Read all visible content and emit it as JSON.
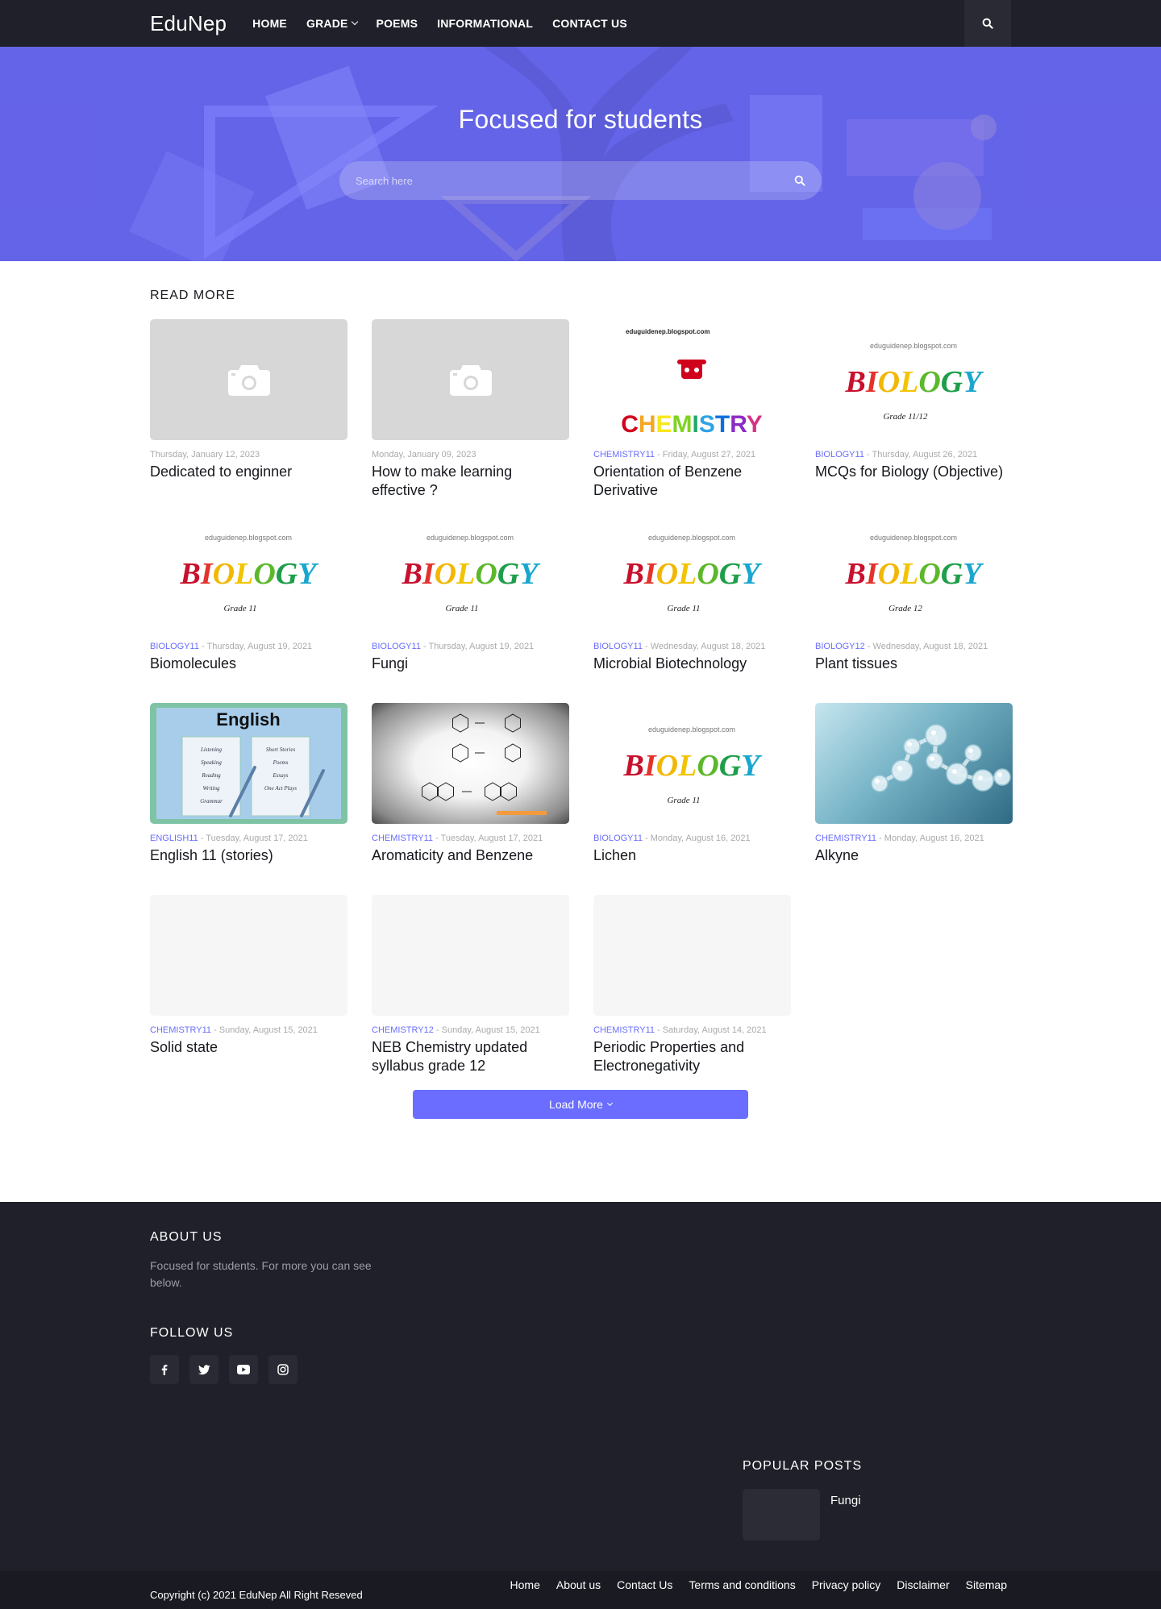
{
  "header": {
    "logo": "EduNep",
    "nav": [
      "HOME",
      "GRADE",
      "POEMS",
      "INFORMATIONAL",
      "CONTACT US"
    ]
  },
  "hero": {
    "title": "Focused for students",
    "search_placeholder": "Search here"
  },
  "main": {
    "section_title": "READ MORE",
    "posts": [
      {
        "label": "",
        "date": "Thursday, January 12, 2023",
        "title": "Dedicated to enginner",
        "thumb": "placeholder"
      },
      {
        "label": "",
        "date": "Monday, January 09, 2023",
        "title": "How to make learning effective ?",
        "thumb": "placeholder"
      },
      {
        "label": "CHEMISTRY11",
        "date": "Friday, August 27, 2021",
        "title": "Orientation of Benzene Derivative",
        "thumb": "chemistry",
        "thumb_site": "eduguidenep.blogspot.com",
        "thumb_word": "CHEMISTRY"
      },
      {
        "label": "BIOLOGY11",
        "date": "Thursday, August 26, 2021",
        "title": "MCQs for Biology (Objective)",
        "thumb": "biology",
        "thumb_site": "eduguidenep.blogspot.com",
        "thumb_word": "BIOLOGY",
        "thumb_grade": "Grade 11/12"
      },
      {
        "label": "BIOLOGY11",
        "date": "Thursday, August 19, 2021",
        "title": "Biomolecules",
        "thumb": "biology",
        "thumb_site": "eduguidenep.blogspot.com",
        "thumb_word": "BIOLOGY",
        "thumb_grade": "Grade 11"
      },
      {
        "label": "BIOLOGY11",
        "date": "Thursday, August 19, 2021",
        "title": "Fungi",
        "thumb": "biology",
        "thumb_site": "eduguidenep.blogspot.com",
        "thumb_word": "BIOLOGY",
        "thumb_grade": "Grade 11"
      },
      {
        "label": "BIOLOGY11",
        "date": "Wednesday, August 18, 2021",
        "title": "Microbial Biotechnology",
        "thumb": "biology",
        "thumb_site": "eduguidenep.blogspot.com",
        "thumb_word": "BIOLOGY",
        "thumb_grade": "Grade 11"
      },
      {
        "label": "BIOLOGY12",
        "date": "Wednesday, August 18, 2021",
        "title": "Plant tissues",
        "thumb": "biology",
        "thumb_site": "eduguidenep.blogspot.com",
        "thumb_word": "BIOLOGY",
        "thumb_grade": "Grade 12"
      },
      {
        "label": "ENGLISH11",
        "date": "Tuesday, August 17, 2021",
        "title": "English 11 (stories)",
        "thumb": "english",
        "thumb_word": "English",
        "thumb_left": [
          "Listening",
          "Speaking",
          "Reading",
          "Writing",
          "Grammar"
        ],
        "thumb_right": [
          "Short Stories",
          "Poems",
          "Essays",
          "One Act Plays"
        ]
      },
      {
        "label": "CHEMISTRY11",
        "date": "Tuesday, August 17, 2021",
        "title": "Aromaticity and Benzene",
        "thumb": "benzene"
      },
      {
        "label": "BIOLOGY11",
        "date": "Monday, August 16, 2021",
        "title": "Lichen",
        "thumb": "biology",
        "thumb_site": "eduguidenep.blogspot.com",
        "thumb_word": "BIOLOGY",
        "thumb_grade": "Grade 11"
      },
      {
        "label": "CHEMISTRY11",
        "date": "Monday, August 16, 2021",
        "title": "Alkyne",
        "thumb": "molecule"
      },
      {
        "label": "CHEMISTRY11",
        "date": "Sunday, August 15, 2021",
        "title": "Solid state",
        "thumb": "empty"
      },
      {
        "label": "CHEMISTRY12",
        "date": "Sunday, August 15, 2021",
        "title": "NEB Chemistry updated syllabus grade 12",
        "thumb": "empty"
      },
      {
        "label": "CHEMISTRY11",
        "date": "Saturday, August 14, 2021",
        "title": "Periodic Properties and Electronegativity",
        "thumb": "empty"
      }
    ],
    "load_more": "Load More"
  },
  "footer": {
    "about_title": "ABOUT US",
    "about_text": "Focused for students. For more you can see below.",
    "follow_title": "FOLLOW US",
    "social": [
      "facebook-icon",
      "twitter-icon",
      "youtube-icon",
      "instagram-icon"
    ],
    "popular_title": "POPULAR POSTS",
    "popular_posts": [
      {
        "title": "Fungi"
      }
    ],
    "copyright": "Copyright (c) 2021 EduNep All Right Reseved",
    "links": [
      "Home",
      "About us",
      "Contact Us",
      "Terms and conditions",
      "Privacy policy",
      "Disclaimer",
      "Sitemap"
    ]
  },
  "colors": {
    "accent": "#6a6dff",
    "dark": "#1f2029",
    "darker": "#1a1b22",
    "placeholder": "#d7d7d7"
  }
}
